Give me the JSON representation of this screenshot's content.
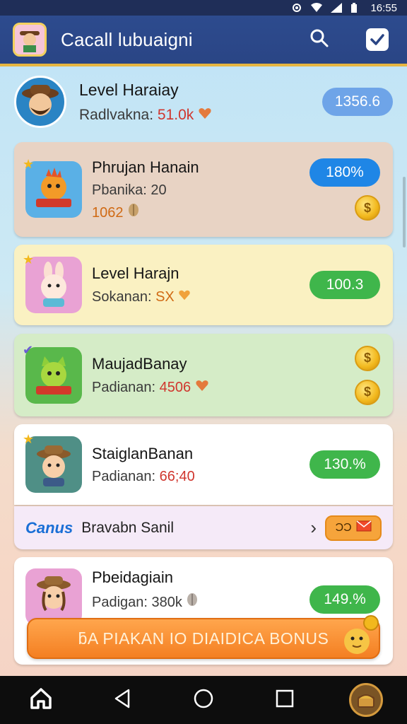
{
  "status_bar": {
    "time": "16:55"
  },
  "header": {
    "title": "Cacall lubuaigni"
  },
  "colors": {
    "header_bg": "#2d4b8e",
    "accent": "#e6b540",
    "green": "#3fb64b",
    "blue": "#1f86e6"
  },
  "top_entry": {
    "name": "Level Haraiay",
    "sub_label": "Radlvakna:",
    "sub_value": "51.0k",
    "pill": "1356.6"
  },
  "cards": [
    {
      "name": "Phrujan Hanain",
      "sub_label": "Pbanika:",
      "sub_value": "20",
      "extra_value": "1062",
      "pill": "180%"
    },
    {
      "name": "Level Harajn",
      "sub_label": "Sokanan:",
      "sub_value": "SX",
      "pill": "100.3"
    },
    {
      "name": "MaujadBanay",
      "sub_label": "Padianan:",
      "sub_value": "4506"
    },
    {
      "name": "StaiglanBanan",
      "sub_label": "Padianan:",
      "sub_value": "66;40",
      "pill": "130.%"
    },
    {
      "name": "Pbeidagiain",
      "sub_label": "Padigan:",
      "sub_value": "380k",
      "pill": "149.%"
    }
  ],
  "promo_row": {
    "brand": "Canus",
    "label": "Bravabn Sanil",
    "chip": "ƆƆ"
  },
  "bonus_button": {
    "label": "ƃA PIAKAN IO DIAIDICA BONUS"
  },
  "coins": {
    "symbol": "$"
  },
  "icons": {
    "search": "search-icon",
    "check": "check-icon",
    "home": "home-icon",
    "back": "back-icon",
    "recent": "recent-apps-icon"
  }
}
